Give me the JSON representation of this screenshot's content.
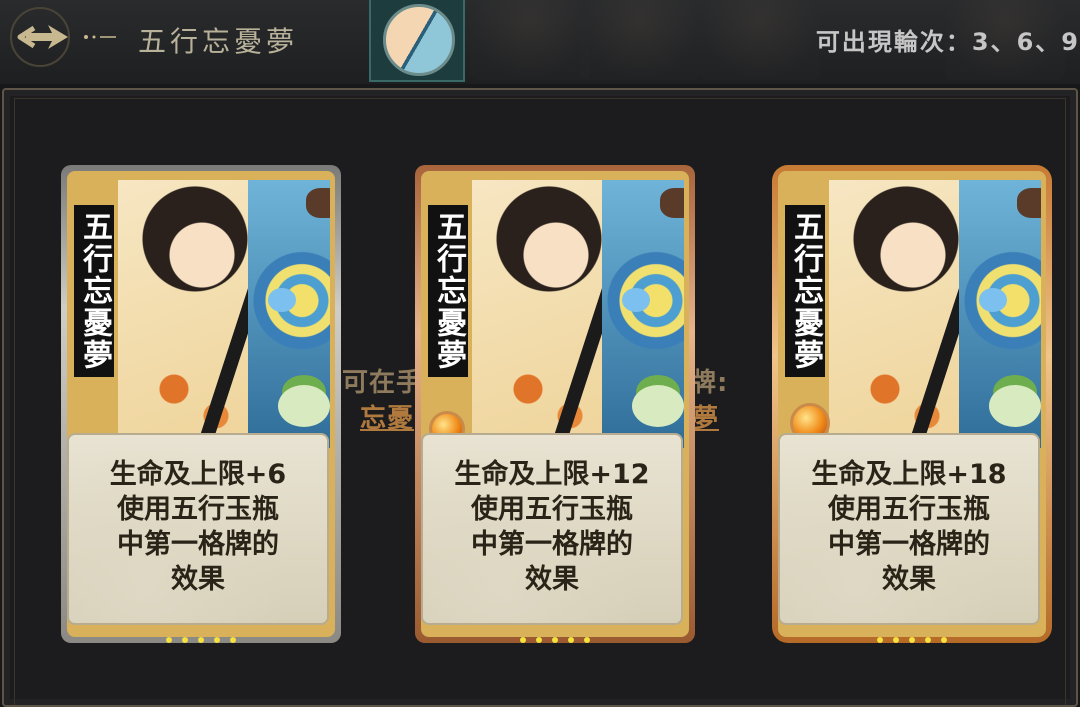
{
  "header": {
    "title": "五行忘憂夢",
    "rounds_text": "可出現輪次：3、6、9"
  },
  "background_text": {
    "line1_left": "可在手",
    "line1_right": "牌:",
    "line2_left": "忘憂",
    "line2_right": "夢"
  },
  "cards": [
    {
      "tier": "silver",
      "name": "五行忘憂夢",
      "effect_lines": [
        "生命及上限+6",
        "使用五行玉瓶",
        "中第一格牌的",
        "效果"
      ]
    },
    {
      "tier": "bronze",
      "name": "五行忘憂夢",
      "effect_lines": [
        "生命及上限+12",
        "使用五行玉瓶",
        "中第一格牌的",
        "效果"
      ]
    },
    {
      "tier": "gold",
      "name": "五行忘憂夢",
      "effect_lines": [
        "生命及上限+18",
        "使用五行玉瓶",
        "中第一格牌的",
        "效果"
      ]
    }
  ],
  "icons": {
    "back": "back-arrow-icon",
    "gem": "orange-gem-icon"
  },
  "colors": {
    "accent": "#b07a3e",
    "title": "#b9b29a",
    "card_text": "#2a2418",
    "dots": "#f4e041"
  }
}
